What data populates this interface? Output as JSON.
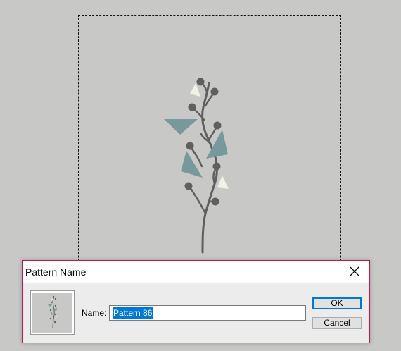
{
  "dialog": {
    "title": "Pattern Name",
    "name_label": "Name:",
    "name_value": "Pattern 86",
    "ok_label": "OK",
    "cancel_label": "Cancel",
    "close_icon": "close-icon"
  },
  "colors": {
    "canvas_bg": "#c8c9c6",
    "branch": "#5f5f5f",
    "leaf_teal": "#77999c",
    "leaf_cream": "#f3f1e6",
    "dialog_border": "#c2185b",
    "selection": "#0078d7"
  }
}
